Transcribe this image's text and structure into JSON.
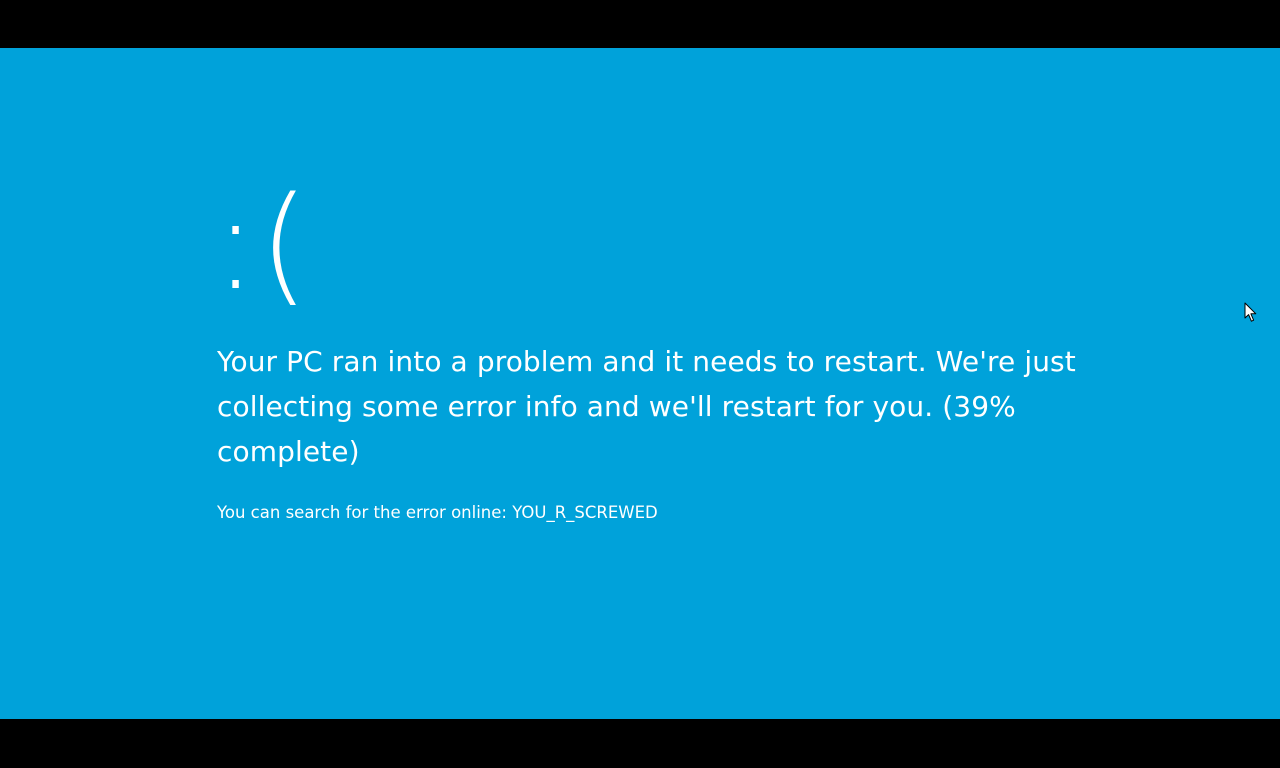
{
  "screen": {
    "background_color": "#00A2DA",
    "text_color": "#FFFFFF",
    "sad_face": ":(",
    "message_prefix": "Your PC ran into a problem and it needs to restart. We're just collecting some error info and we'll restart for you. (",
    "progress_percent": "39%",
    "message_suffix": " complete)",
    "search_prefix": "You can search for the error online: ",
    "error_code": "YOU_R_SCREWED"
  },
  "icons": {
    "cursor": "mouse-pointer-icon"
  }
}
